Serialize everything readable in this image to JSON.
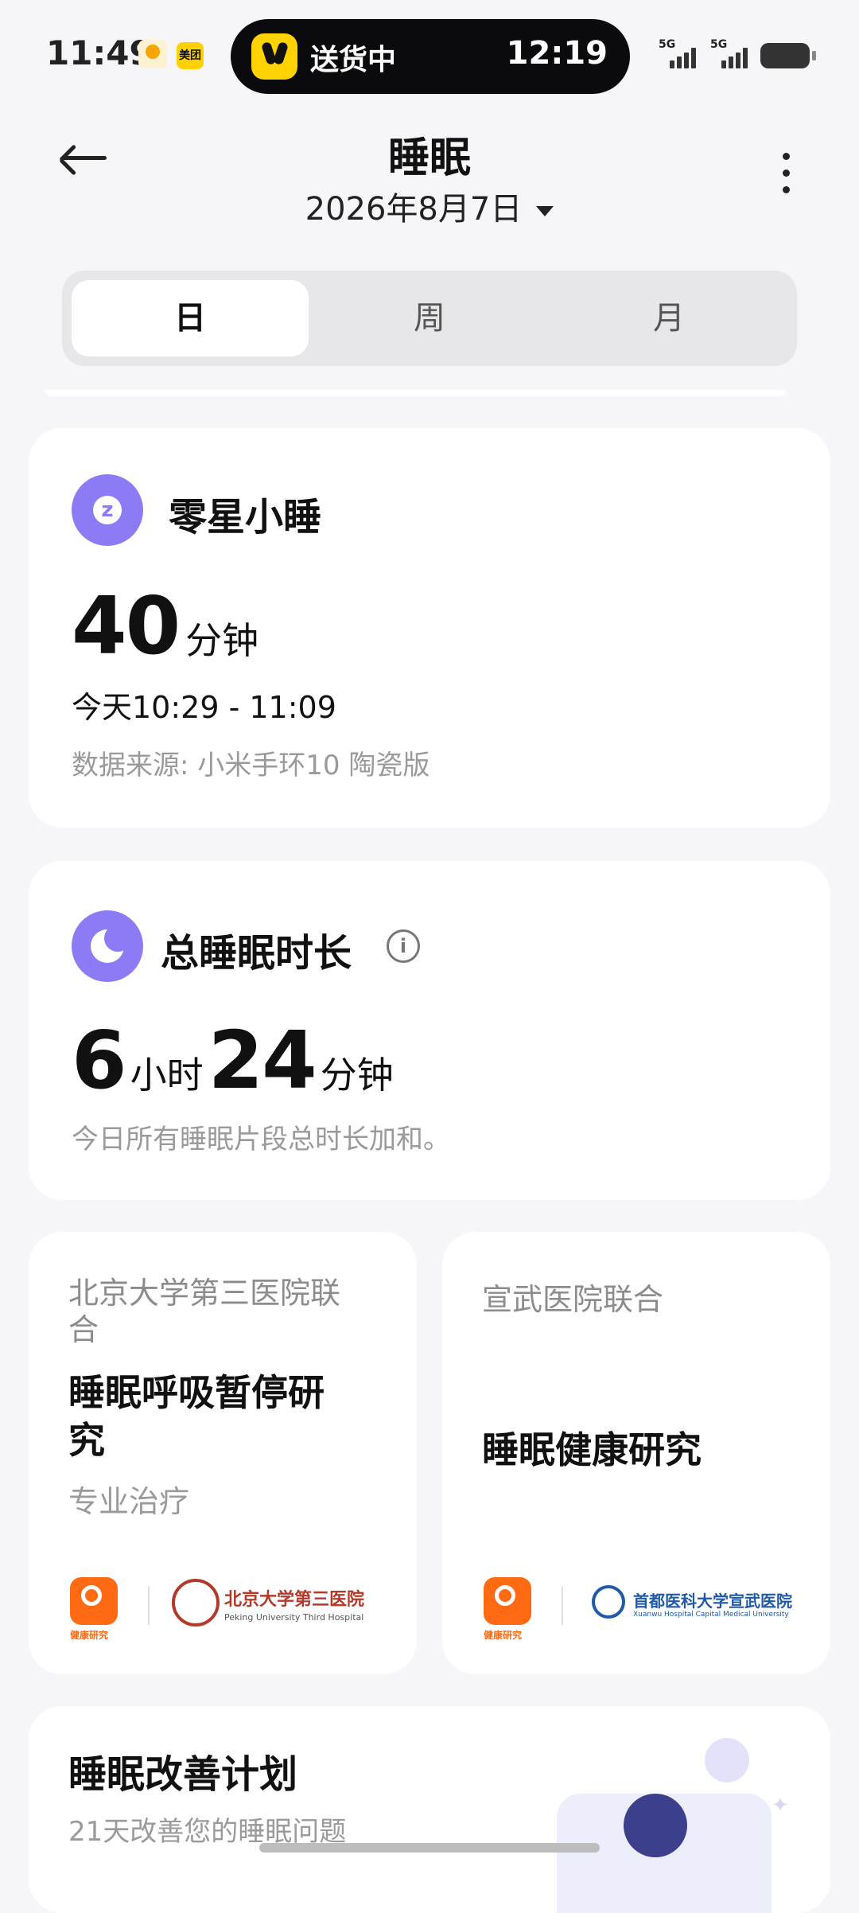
{
  "status": {
    "time": "11:49",
    "app_badge_2": "美团",
    "island_text": "送货中",
    "island_time": "12:19",
    "signal1_label": "5G",
    "signal2_label": "5G"
  },
  "header": {
    "title": "睡眠",
    "date": "2026年8月7日"
  },
  "tabs": [
    {
      "label": "日",
      "active": true
    },
    {
      "label": "周",
      "active": false
    },
    {
      "label": "月",
      "active": false
    }
  ],
  "nap_card": {
    "title": "零星小睡",
    "value": "40",
    "unit": "分钟",
    "time_range": "今天10:29 - 11:09",
    "source": "数据来源: 小米手环10 陶瓷版"
  },
  "total_card": {
    "title": "总睡眠时长",
    "hours": "6",
    "hours_unit": "小时",
    "minutes": "24",
    "minutes_unit": "分钟",
    "note": "今日所有睡眠片段总时长加和。"
  },
  "study_left": {
    "partner_line1": "北京大学第三医院联",
    "partner_line2": "合",
    "title_line1": "睡眠呼吸暂停研",
    "title_line2": "究",
    "subtitle": "专业治疗",
    "badge_text": "健康研究",
    "hospital_cn": "北京大学第三医院",
    "hospital_en": "Peking University Third Hospital"
  },
  "study_right": {
    "partner": "宣武医院联合",
    "title": "睡眠健康研究",
    "badge_text": "健康研究",
    "hospital_cn": "首都医科大学宣武医院",
    "hospital_en": "Xuanwu Hospital Capital Medical University"
  },
  "plan_card": {
    "title": "睡眠改善计划",
    "subtitle": "21天改善您的睡眠问题"
  }
}
